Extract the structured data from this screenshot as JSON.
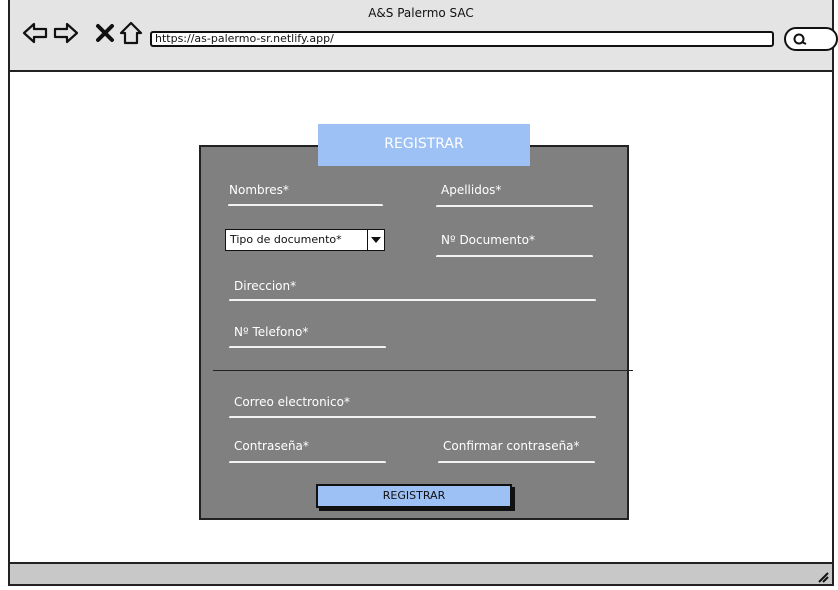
{
  "window": {
    "title": "A&S Palermo SAC"
  },
  "browser": {
    "url": "https://as-palermo-sr.netlify.app/",
    "icons": [
      "back-arrow-icon",
      "forward-arrow-icon",
      "close-x-icon",
      "home-icon",
      "search-icon",
      "resize-handle-icon"
    ]
  },
  "form": {
    "tab_title": "REGISTRAR",
    "nombres": "Nombres*",
    "apellidos": "Apellidos*",
    "tipo_documento": "Tipo de documento*",
    "num_documento": "Nº Documento*",
    "direccion": "Direccion*",
    "telefono": "Nº Telefono*",
    "correo": "Correo electronico*",
    "contrasena": "Contraseña*",
    "confirmar": "Confirmar contraseña*",
    "submit_label": "REGISTRAR"
  },
  "colors": {
    "accent": "#9dc0f5",
    "panel": "#808080",
    "chrome": "#e4e4e4"
  }
}
